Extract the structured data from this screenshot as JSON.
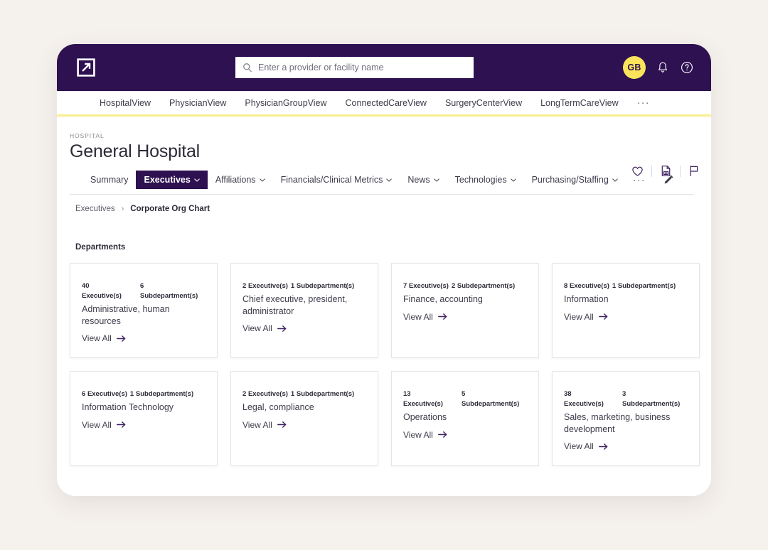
{
  "topbar": {
    "logo_name": "external-link-square-logo",
    "search": {
      "placeholder": "Enter a provider or facility name",
      "value": "",
      "icon": "search-icon"
    },
    "avatar_initials": "GB",
    "notifications_icon": "bell-icon",
    "help_icon": "help-circle-icon",
    "background_color": "#2D1150",
    "avatar_color": "#FBE45B"
  },
  "product_nav": {
    "items": [
      {
        "label": "HospitalView"
      },
      {
        "label": "PhysicianView"
      },
      {
        "label": "PhysicianGroupView"
      },
      {
        "label": "ConnectedCareView"
      },
      {
        "label": "SurgeryCenterView"
      },
      {
        "label": "LongTermCareView"
      }
    ],
    "more_label": "···",
    "underline_color": "#FBEE8C"
  },
  "page_header": {
    "eyebrow": "HOSPITAL",
    "title": "General Hospital",
    "actions": [
      {
        "name": "favorite-heart-icon"
      },
      {
        "name": "export-document-icon"
      },
      {
        "name": "flag-icon"
      }
    ]
  },
  "tabs": {
    "items": [
      {
        "label": "Summary",
        "has_chevron": false,
        "active": false
      },
      {
        "label": "Executives",
        "has_chevron": true,
        "active": true
      },
      {
        "label": "Affiliations",
        "has_chevron": true,
        "active": false
      },
      {
        "label": "Financials/Clinical Metrics",
        "has_chevron": true,
        "active": false
      },
      {
        "label": "News",
        "has_chevron": true,
        "active": false
      },
      {
        "label": "Technologies",
        "has_chevron": true,
        "active": false
      },
      {
        "label": "Purchasing/Staffing",
        "has_chevron": true,
        "active": false
      }
    ],
    "more_label": "···",
    "edit_icon": "pencil-edit-icon",
    "active_color": "#2D1150"
  },
  "breadcrumb": {
    "parent": "Executives",
    "separator": "›",
    "current": "Corporate Org Chart"
  },
  "departments": {
    "section_title": "Departments",
    "view_all_label": "View All",
    "executive_label": "Executive(s)",
    "subdepartment_label": "Subdepartment(s)",
    "cards": [
      {
        "executives": "40",
        "subdepartments": "6",
        "name": "Administrative, human resources",
        "stacked": true
      },
      {
        "executives": "2",
        "subdepartments": "1",
        "name": "Chief executive, president, administrator",
        "stacked": false
      },
      {
        "executives": "7",
        "subdepartments": "2",
        "name": "Finance, accounting",
        "stacked": false
      },
      {
        "executives": "8",
        "subdepartments": "1",
        "name": "Information",
        "stacked": false
      },
      {
        "executives": "6",
        "subdepartments": "1",
        "name": "Information Technology",
        "stacked": false
      },
      {
        "executives": "2",
        "subdepartments": "1",
        "name": "Legal, compliance",
        "stacked": false
      },
      {
        "executives": "13",
        "subdepartments": "5",
        "name": "Operations",
        "stacked": true
      },
      {
        "executives": "38",
        "subdepartments": "3",
        "name": "Sales, marketing, business development",
        "stacked": true
      }
    ]
  }
}
